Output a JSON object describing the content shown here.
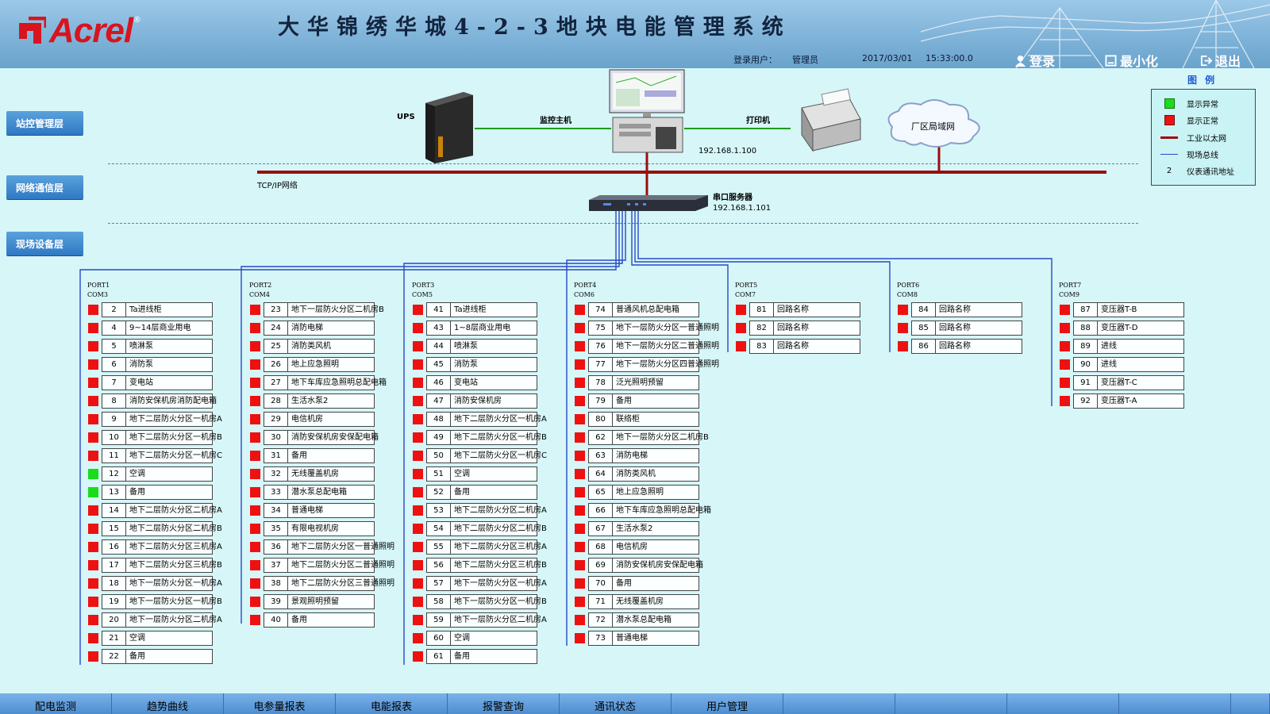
{
  "header": {
    "logo": "Acrel",
    "logo_mark": "®",
    "title": "大华锦绣华城4-2-3地块电能管理系统",
    "login_user_label": "登录用户：",
    "login_user": "管理员",
    "date": "2017/03/01",
    "time": "15:33:00.0",
    "buttons": {
      "login": "登录",
      "minimize": "最小化",
      "exit": "退出"
    }
  },
  "layers": [
    "站控管理层",
    "网络通信层",
    "现场设备层"
  ],
  "network": {
    "ups": "UPS",
    "host": "监控主机",
    "host_ip": "192.168.1.100",
    "printer": "打印机",
    "lan": "厂区局域网",
    "tcp": "TCP/IP网络",
    "serial_server": "串口服务器",
    "serial_ip": "192.168.1.101"
  },
  "legend": {
    "title": "图 例",
    "items": [
      "显示异常",
      "显示正常",
      "工业以太网",
      "现场总线",
      "仪表通讯地址"
    ],
    "addr_sample": "2",
    "colors": {
      "abnormal": "#1bdc1b",
      "normal": "#ee1111",
      "ethernet": "#9a0e0e",
      "fieldbus": "#2848c8"
    }
  },
  "ports": [
    {
      "port": "PORT1",
      "com": "COM3",
      "devices": [
        {
          "n": "2",
          "name": "Ta进线柜",
          "s": "r"
        },
        {
          "n": "4",
          "name": "9~14层商业用电",
          "s": "r"
        },
        {
          "n": "5",
          "name": "喷淋泵",
          "s": "r"
        },
        {
          "n": "6",
          "name": "消防泵",
          "s": "r"
        },
        {
          "n": "7",
          "name": "变电站",
          "s": "r"
        },
        {
          "n": "8",
          "name": "消防安保机房消防配电箱",
          "s": "r"
        },
        {
          "n": "9",
          "name": "地下二层防火分区一机房A",
          "s": "r"
        },
        {
          "n": "10",
          "name": "地下二层防火分区一机房B",
          "s": "r"
        },
        {
          "n": "11",
          "name": "地下二层防火分区一机房C",
          "s": "r"
        },
        {
          "n": "12",
          "name": "空调",
          "s": "g"
        },
        {
          "n": "13",
          "name": "备用",
          "s": "g"
        },
        {
          "n": "14",
          "name": "地下二层防火分区二机房A",
          "s": "r"
        },
        {
          "n": "15",
          "name": "地下二层防火分区二机房B",
          "s": "r"
        },
        {
          "n": "16",
          "name": "地下二层防火分区三机房A",
          "s": "r"
        },
        {
          "n": "17",
          "name": "地下二层防火分区三机房B",
          "s": "r"
        },
        {
          "n": "18",
          "name": "地下一层防火分区一机房A",
          "s": "r"
        },
        {
          "n": "19",
          "name": "地下一层防火分区一机房B",
          "s": "r"
        },
        {
          "n": "20",
          "name": "地下一层防火分区二机房A",
          "s": "r"
        },
        {
          "n": "21",
          "name": "空调",
          "s": "r"
        },
        {
          "n": "22",
          "name": "备用",
          "s": "r"
        }
      ]
    },
    {
      "port": "PORT2",
      "com": "COM4",
      "devices": [
        {
          "n": "23",
          "name": "地下一层防火分区二机房B",
          "s": "r"
        },
        {
          "n": "24",
          "name": "消防电梯",
          "s": "r"
        },
        {
          "n": "25",
          "name": "消防类风机",
          "s": "r"
        },
        {
          "n": "26",
          "name": "地上应急照明",
          "s": "r"
        },
        {
          "n": "27",
          "name": "地下车库应急照明总配电箱",
          "s": "r"
        },
        {
          "n": "28",
          "name": "生活水泵2",
          "s": "r"
        },
        {
          "n": "29",
          "name": "电信机房",
          "s": "r"
        },
        {
          "n": "30",
          "name": "消防安保机房安保配电箱",
          "s": "r"
        },
        {
          "n": "31",
          "name": "备用",
          "s": "r"
        },
        {
          "n": "32",
          "name": "无线覆盖机房",
          "s": "r"
        },
        {
          "n": "33",
          "name": "潜水泵总配电箱",
          "s": "r"
        },
        {
          "n": "34",
          "name": "普通电梯",
          "s": "r"
        },
        {
          "n": "35",
          "name": "有限电视机房",
          "s": "r"
        },
        {
          "n": "36",
          "name": "地下二层防火分区一普通照明",
          "s": "r"
        },
        {
          "n": "37",
          "name": "地下二层防火分区二普通照明",
          "s": "r"
        },
        {
          "n": "38",
          "name": "地下二层防火分区三普通照明",
          "s": "r"
        },
        {
          "n": "39",
          "name": "景观照明预留",
          "s": "r"
        },
        {
          "n": "40",
          "name": "备用",
          "s": "r"
        }
      ]
    },
    {
      "port": "PORT3",
      "com": "COM5",
      "devices": [
        {
          "n": "41",
          "name": "Ta进线柜",
          "s": "r"
        },
        {
          "n": "43",
          "name": "1~8层商业用电",
          "s": "r"
        },
        {
          "n": "44",
          "name": "喷淋泵",
          "s": "r"
        },
        {
          "n": "45",
          "name": "消防泵",
          "s": "r"
        },
        {
          "n": "46",
          "name": "变电站",
          "s": "r"
        },
        {
          "n": "47",
          "name": "消防安保机房",
          "s": "r"
        },
        {
          "n": "48",
          "name": "地下二层防火分区一机房A",
          "s": "r"
        },
        {
          "n": "49",
          "name": "地下二层防火分区一机房B",
          "s": "r"
        },
        {
          "n": "50",
          "name": "地下二层防火分区一机房C",
          "s": "r"
        },
        {
          "n": "51",
          "name": "空调",
          "s": "r"
        },
        {
          "n": "52",
          "name": "备用",
          "s": "r"
        },
        {
          "n": "53",
          "name": "地下二层防火分区二机房A",
          "s": "r"
        },
        {
          "n": "54",
          "name": "地下二层防火分区二机房B",
          "s": "r"
        },
        {
          "n": "55",
          "name": "地下二层防火分区三机房A",
          "s": "r"
        },
        {
          "n": "56",
          "name": "地下二层防火分区三机房B",
          "s": "r"
        },
        {
          "n": "57",
          "name": "地下一层防火分区一机房A",
          "s": "r"
        },
        {
          "n": "58",
          "name": "地下一层防火分区一机房B",
          "s": "r"
        },
        {
          "n": "59",
          "name": "地下一层防火分区二机房A",
          "s": "r"
        },
        {
          "n": "60",
          "name": "空调",
          "s": "r"
        },
        {
          "n": "61",
          "name": "备用",
          "s": "r"
        }
      ]
    },
    {
      "port": "PORT4",
      "com": "COM6",
      "devices": [
        {
          "n": "74",
          "name": "普通风机总配电箱",
          "s": "r"
        },
        {
          "n": "75",
          "name": "地下一层防火分区一普通照明",
          "s": "r"
        },
        {
          "n": "76",
          "name": "地下一层防火分区二普通照明",
          "s": "r"
        },
        {
          "n": "77",
          "name": "地下一层防火分区四普通照明",
          "s": "r"
        },
        {
          "n": "78",
          "name": "泛光照明预留",
          "s": "r"
        },
        {
          "n": "79",
          "name": "备用",
          "s": "r"
        },
        {
          "n": "80",
          "name": "联络柜",
          "s": "r"
        },
        {
          "n": "62",
          "name": "地下一层防火分区二机房B",
          "s": "r"
        },
        {
          "n": "63",
          "name": "消防电梯",
          "s": "r"
        },
        {
          "n": "64",
          "name": "消防类风机",
          "s": "r"
        },
        {
          "n": "65",
          "name": "地上应急照明",
          "s": "r"
        },
        {
          "n": "66",
          "name": "地下车库应急照明总配电箱",
          "s": "r"
        },
        {
          "n": "67",
          "name": "生活水泵2",
          "s": "r"
        },
        {
          "n": "68",
          "name": "电信机房",
          "s": "r"
        },
        {
          "n": "69",
          "name": "消防安保机房安保配电箱",
          "s": "r"
        },
        {
          "n": "70",
          "name": "备用",
          "s": "r"
        },
        {
          "n": "71",
          "name": "无线覆盖机房",
          "s": "r"
        },
        {
          "n": "72",
          "name": "潜水泵总配电箱",
          "s": "r"
        },
        {
          "n": "73",
          "name": "普通电梯",
          "s": "r"
        }
      ]
    },
    {
      "port": "PORT5",
      "com": "COM7",
      "devices": [
        {
          "n": "81",
          "name": "回路名称",
          "s": "r"
        },
        {
          "n": "82",
          "name": "回路名称",
          "s": "r"
        },
        {
          "n": "83",
          "name": "回路名称",
          "s": "r"
        }
      ]
    },
    {
      "port": "PORT6",
      "com": "COM8",
      "devices": [
        {
          "n": "84",
          "name": "回路名称",
          "s": "r"
        },
        {
          "n": "85",
          "name": "回路名称",
          "s": "r"
        },
        {
          "n": "86",
          "name": "回路名称",
          "s": "r"
        }
      ]
    },
    {
      "port": "PORT7",
      "com": "COM9",
      "devices": [
        {
          "n": "87",
          "name": "变压器T-B",
          "s": "r"
        },
        {
          "n": "88",
          "name": "变压器T-D",
          "s": "r"
        },
        {
          "n": "89",
          "name": "进线",
          "s": "r"
        },
        {
          "n": "90",
          "name": "进线",
          "s": "r"
        },
        {
          "n": "91",
          "name": "变压器T-C",
          "s": "r"
        },
        {
          "n": "92",
          "name": "变压器T-A",
          "s": "r"
        }
      ]
    }
  ],
  "tabs": [
    "配电监测",
    "趋势曲线",
    "电参量报表",
    "电能报表",
    "报警查询",
    "通讯状态",
    "用户管理",
    "",
    "",
    "",
    "",
    ""
  ]
}
